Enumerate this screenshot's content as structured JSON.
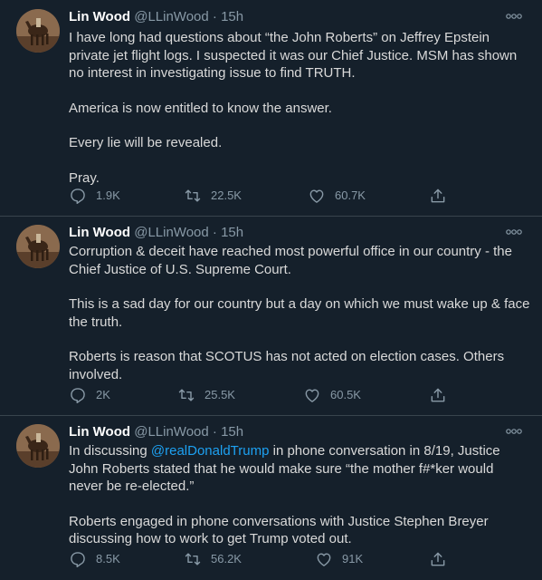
{
  "tweets": [
    {
      "name": "Lin Wood",
      "handle": "@LLinWood",
      "sep": "·",
      "time": "15h",
      "paragraphs": [
        "I have long had questions about “the John Roberts” on Jeffrey Epstein private jet flight logs.  I suspected it was our Chief Justice. MSM has shown no interest in investigating issue to find TRUTH.",
        "America is now entitled to know the answer.",
        "Every lie will be revealed.",
        "Pray."
      ],
      "replies": "1.9K",
      "retweets": "22.5K",
      "likes": "60.7K"
    },
    {
      "name": "Lin Wood",
      "handle": "@LLinWood",
      "sep": "·",
      "time": "15h",
      "paragraphs": [
        "Corruption & deceit have reached most powerful office in our country - the Chief Justice of U.S. Supreme Court.",
        "This is a sad day for our country but a day on which we must wake up & face the truth.",
        "Roberts is reason that SCOTUS has not acted on election cases. Others involved."
      ],
      "replies": "2K",
      "retweets": "25.5K",
      "likes": "60.5K"
    },
    {
      "name": "Lin Wood",
      "handle": "@LLinWood",
      "sep": "·",
      "time": "15h",
      "p1_before": "In discussing ",
      "p1_mention": "@realDonaldTrump",
      "p1_after": " in phone conversation in 8/19, Justice John Roberts stated that he would make sure “the mother f#*ker would never be re-elected.”",
      "p2": "Roberts engaged in phone conversations with Justice Stephen Breyer discussing how to work to get Trump voted out.",
      "replies": "8.5K",
      "retweets": "56.2K",
      "likes": "91K"
    }
  ],
  "colors": {
    "background": "#15202b",
    "divider": "#38444d",
    "text": "#d9d9d9",
    "secondary": "#8899a6",
    "link": "#1da1f2"
  },
  "icons": [
    "avatar-photo",
    "more-icon",
    "reply-icon",
    "retweet-icon",
    "like-icon",
    "share-icon"
  ]
}
